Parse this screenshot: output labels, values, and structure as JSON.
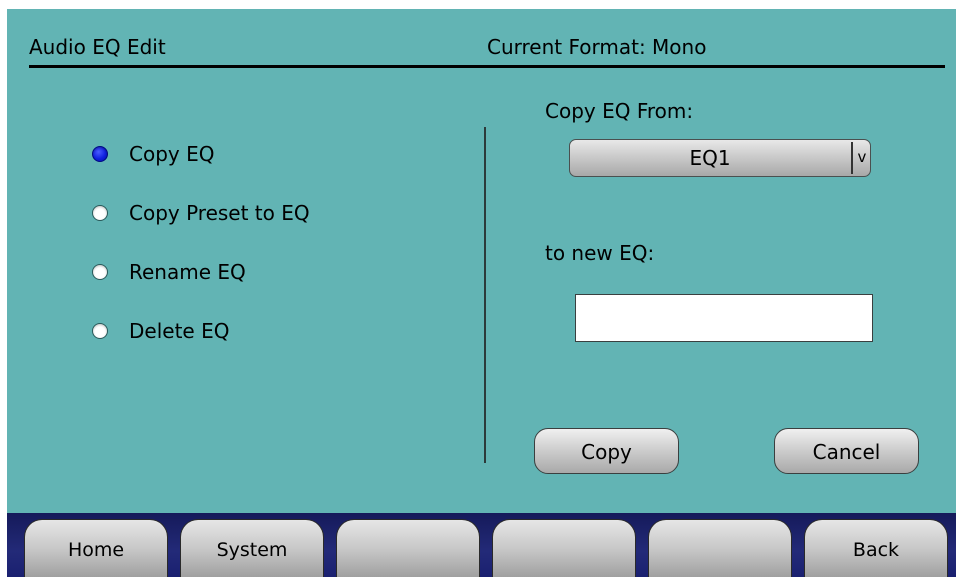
{
  "header": {
    "title": "Audio EQ Edit",
    "current_format": "Current Format: Mono"
  },
  "options": [
    {
      "label": "Copy EQ",
      "selected": true
    },
    {
      "label": "Copy Preset to EQ",
      "selected": false
    },
    {
      "label": "Rename EQ",
      "selected": false
    },
    {
      "label": "Delete EQ",
      "selected": false
    }
  ],
  "copy_panel": {
    "from_label": "Copy EQ From:",
    "from_value": "EQ1",
    "dropdown_icon": "chevron-down-icon",
    "to_label": "to new EQ:",
    "to_value": "",
    "copy_label": "Copy",
    "cancel_label": "Cancel"
  },
  "footer": {
    "buttons": [
      {
        "label": "Home"
      },
      {
        "label": "System"
      },
      {
        "label": ""
      },
      {
        "label": ""
      },
      {
        "label": ""
      },
      {
        "label": "Back"
      }
    ]
  },
  "colors": {
    "background": "#62b4b4",
    "footer": "#1e2570",
    "selected_radio": "#1020e0"
  }
}
